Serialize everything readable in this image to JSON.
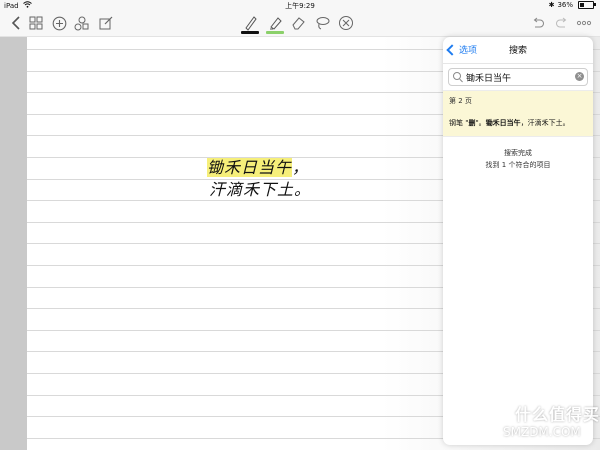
{
  "status": {
    "device": "iPad",
    "time": "上午9:29",
    "battery": "36%",
    "battery_level": 0.36
  },
  "toolbar": {
    "left_icons": [
      "chevron-left-icon",
      "grid-icon",
      "plus-circle-icon",
      "shapes-icon",
      "edit-icon"
    ],
    "center_tools": [
      {
        "name": "pen-tool-icon",
        "underline": "#111111"
      },
      {
        "name": "highlighter-tool-icon",
        "underline": "#8bd06a"
      },
      {
        "name": "eraser-tool-icon",
        "underline": ""
      },
      {
        "name": "lasso-tool-icon",
        "underline": ""
      },
      {
        "name": "close-circle-icon",
        "underline": ""
      }
    ],
    "right_icons": [
      "undo-icon",
      "redo-icon",
      "more-icon"
    ]
  },
  "handwriting": {
    "line1_highlight": "锄禾日当午",
    "line1_rest": "，",
    "line2": "汗滴禾下土。",
    "highlight_color": "#f6ef7a"
  },
  "search_panel": {
    "back_label": "选项",
    "title": "搜索",
    "query": "锄禾日当午",
    "result": {
      "page": "第 2 页",
      "prefix": "钢笔 \"",
      "bold1": "删",
      "mid": "\"。",
      "bold2": "锄禾日当午",
      "suffix": "，汗滴禾下土。"
    },
    "status_line1": "搜索完成",
    "status_line2": "找到 1 个符合的项目"
  },
  "watermark": {
    "logo_text": "值",
    "title": "什么值得买",
    "site": "SMZDM.COM"
  },
  "colors": {
    "accent": "#1e7cf0",
    "result_bg": "#fbf7d6"
  }
}
